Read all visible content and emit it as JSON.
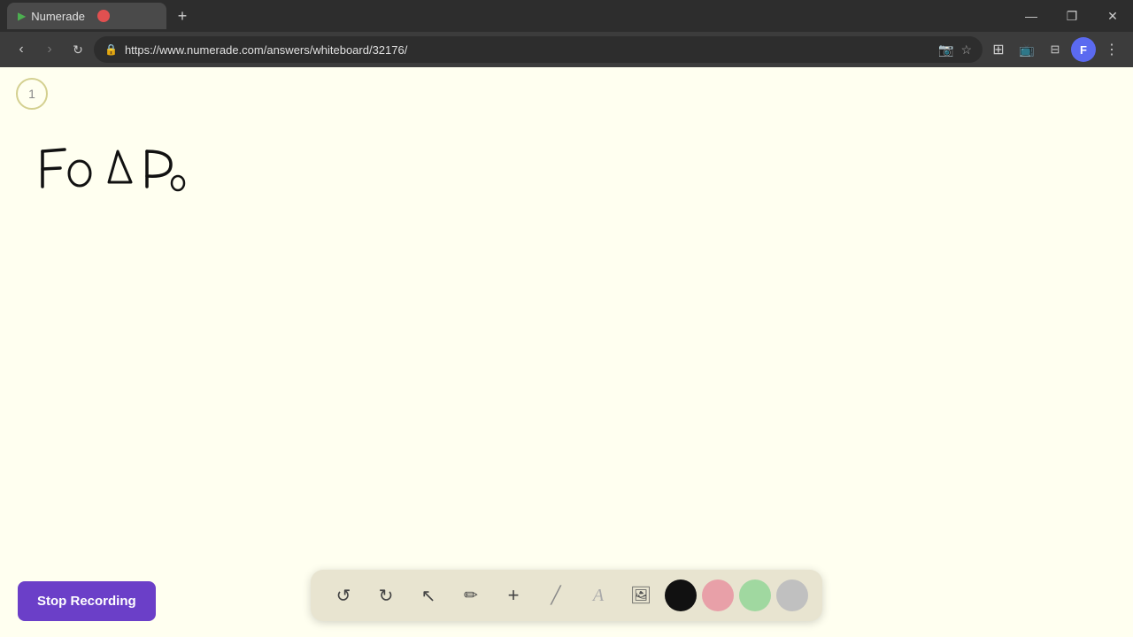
{
  "browser": {
    "tab": {
      "title": "Numerade",
      "favicon": "▶",
      "url": "https://www.numerade.com/answers/whiteboard/32176/"
    },
    "window_controls": {
      "minimize": "—",
      "maximize": "❐",
      "close": "✕"
    }
  },
  "toolbar": {
    "undo_label": "↺",
    "redo_label": "↻",
    "select_label": "↖",
    "pen_label": "✏",
    "add_label": "+",
    "highlight_label": "╱",
    "text_label": "A",
    "image_label": "🖼",
    "stop_recording_label": "Stop Recording"
  },
  "colors": {
    "black": "#111111",
    "pink": "#e8a0a8",
    "green": "#a0d8a0",
    "gray": "#c0c0c0",
    "toolbar_bg": "#e8e4d0",
    "canvas_bg": "#fffff0",
    "stop_btn_bg": "#6b3fc8",
    "tab_active_bg": "#4a4a4a",
    "browser_bg": "#3c3c3c"
  },
  "page": {
    "number": "1",
    "url_display": "https://www.numerade.com/answers/whiteboard/32176/"
  }
}
